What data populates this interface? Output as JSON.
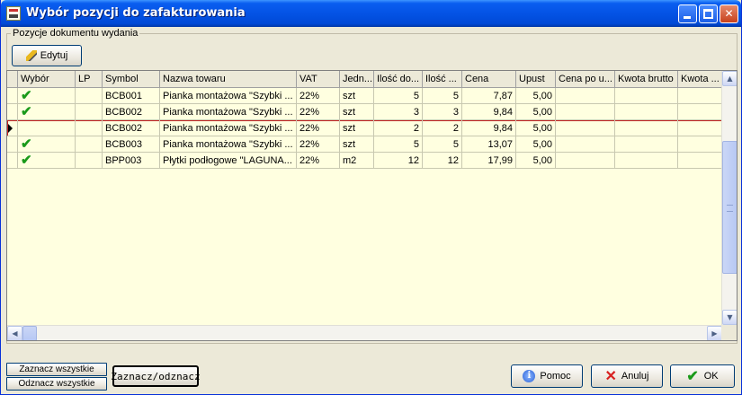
{
  "window": {
    "title": "Wybór pozycji do zafakturowania"
  },
  "group": {
    "label": "Pozycje dokumentu wydania"
  },
  "toolbar": {
    "edit_label": "Edytuj"
  },
  "grid": {
    "columns": [
      "Wybór",
      "LP",
      "Symbol",
      "Nazwa towaru",
      "VAT",
      "Jedn...",
      "Ilość do...",
      "Ilość ...",
      "Cena",
      "Upust",
      "Cena po u...",
      "Kwota brutto",
      "Kwota ..."
    ],
    "rows": [
      {
        "selected": true,
        "lp": "",
        "symbol": "BCB001",
        "name": "Pianka montażowa \"Szybki ...",
        "vat": "22%",
        "unit": "szt",
        "qty_to": "5",
        "qty": "5",
        "price": "7,87",
        "discount": "5,00",
        "price_after": "",
        "gross": "",
        "amount": ""
      },
      {
        "selected": true,
        "lp": "",
        "symbol": "BCB002",
        "name": "Pianka montażowa \"Szybki ...",
        "vat": "22%",
        "unit": "szt",
        "qty_to": "3",
        "qty": "3",
        "price": "9,84",
        "discount": "5,00",
        "price_after": "",
        "gross": "",
        "amount": ""
      },
      {
        "selected": false,
        "lp": "",
        "symbol": "BCB002",
        "name": "Pianka montażowa \"Szybki ...",
        "vat": "22%",
        "unit": "szt",
        "qty_to": "2",
        "qty": "2",
        "price": "9,84",
        "discount": "5,00",
        "price_after": "",
        "gross": "",
        "amount": ""
      },
      {
        "selected": true,
        "lp": "",
        "symbol": "BCB003",
        "name": "Pianka montażowa \"Szybki ...",
        "vat": "22%",
        "unit": "szt",
        "qty_to": "5",
        "qty": "5",
        "price": "13,07",
        "discount": "5,00",
        "price_after": "",
        "gross": "",
        "amount": ""
      },
      {
        "selected": true,
        "lp": "",
        "symbol": "BPP003",
        "name": "Płytki podłogowe \"LAGUNA...",
        "vat": "22%",
        "unit": "m2",
        "qty_to": "12",
        "qty": "12",
        "price": "17,99",
        "discount": "5,00",
        "price_after": "",
        "gross": "",
        "amount": ""
      }
    ]
  },
  "buttons": {
    "select_all": "Zaznacz wszystkie",
    "deselect_all": "Odznacz wszystkie",
    "toggle": "Zaznacz/odznacz",
    "help": "Pomoc",
    "cancel": "Anuluj",
    "ok": "OK"
  },
  "icons": {
    "edit": "pencil-icon",
    "help": "info-icon",
    "cancel": "x-icon",
    "ok": "checkmark-icon",
    "selected": "checkmark-icon",
    "current_row": "row-pointer-icon"
  },
  "colors": {
    "titlebar": "#0453e5",
    "grid_bg": "#ffffe0",
    "check": "#1a9a1a",
    "selected_row_border": "#c02020"
  }
}
